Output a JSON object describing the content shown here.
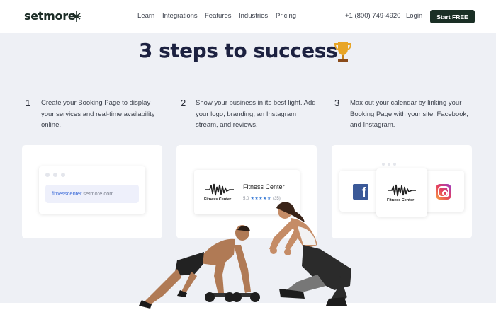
{
  "brand": {
    "name": "setmore"
  },
  "nav": {
    "links": [
      "Learn",
      "Integrations",
      "Features",
      "Industries",
      "Pricing"
    ],
    "phone": "+1 (800) 749-4920",
    "login": "Login",
    "cta": "Start FREE"
  },
  "hero": {
    "title": "3 steps to success"
  },
  "steps": [
    {
      "number": "1",
      "text": "Create your Booking Page to display your services and real-time availability online."
    },
    {
      "number": "2",
      "text": "Show your business in its best light. Add your logo, branding, an Instagram stream, and reviews."
    },
    {
      "number": "3",
      "text": "Max out your calendar by linking your Booking Page with your site, Facebook, and Instagram."
    }
  ],
  "card1": {
    "url_highlight": "fitnesscenter",
    "url_rest": ".setmore.com"
  },
  "card2": {
    "logo_text": "Fitness Center",
    "title": "Fitness Center",
    "rating_num": "5.0",
    "stars": "★★★★★",
    "rating_count": "(35)"
  },
  "card3": {
    "logo_text": "Fitness Center"
  },
  "colors": {
    "accent_dark_green": "#1a2f25",
    "heading_navy": "#1c2140",
    "link_blue": "#3c6bd8",
    "facebook": "#3b5998",
    "star_blue": "#3a7bd5"
  },
  "icons": [
    "setmore-logo-icon",
    "trophy-icon",
    "facebook-icon",
    "instagram-icon",
    "fitness-pulse-logo-icon"
  ]
}
